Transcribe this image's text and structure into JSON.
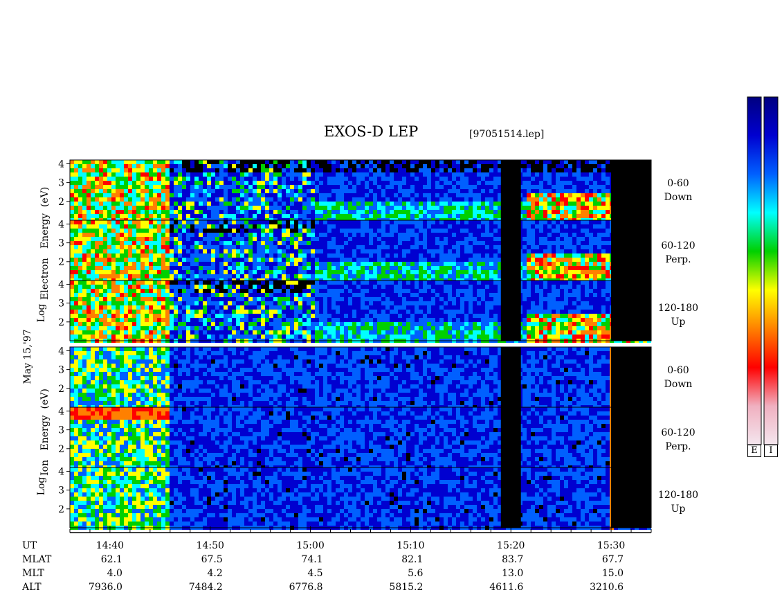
{
  "header": {
    "title": "EXOS-D LEP",
    "filename": "[97051514.lep]"
  },
  "date_label": "May 15,'97",
  "electron_axis_label": [
    "Electron",
    "Energy",
    "(eV)"
  ],
  "electron_axis_prefix": "Log",
  "ion_axis_label": [
    "Ion",
    "Energy",
    "(eV)"
  ],
  "ion_axis_prefix": "Log",
  "panels_electron": [
    {
      "angle": "0-60",
      "dir": "Down"
    },
    {
      "angle": "60-120",
      "dir": "Perp."
    },
    {
      "angle": "120-180",
      "dir": "Up"
    }
  ],
  "panels_ion": [
    {
      "angle": "0-60",
      "dir": "Down"
    },
    {
      "angle": "60-120",
      "dir": "Perp."
    },
    {
      "angle": "120-180",
      "dir": "Up"
    }
  ],
  "colorbar_tags": [
    "E",
    "I"
  ],
  "colors": {
    "colorbar": [
      "#f4e6ee",
      "#f0b0c0",
      "#ff0000",
      "#ff8000",
      "#ffff00",
      "#00d000",
      "#00ffff",
      "#0060ff",
      "#0000d0",
      "#000080"
    ],
    "data_gap": "#000000"
  },
  "chart_data": {
    "type": "heatmap",
    "title": "EXOS-D LEP",
    "xlabel": "UT",
    "ylabel": "Log Energy (eV)",
    "y_ticks": [
      "2",
      "3",
      "4"
    ],
    "ylim": [
      1,
      4.2
    ],
    "x_ticks": [
      "14:40",
      "14:50",
      "15:00",
      "15:10",
      "15:20",
      "15:30"
    ],
    "ephemeris": [
      {
        "label": "UT",
        "values": [
          "14:40",
          "14:50",
          "15:00",
          "15:10",
          "15:20",
          "15:30"
        ]
      },
      {
        "label": "MLAT",
        "values": [
          "62.1",
          "67.5",
          "74.1",
          "82.1",
          "83.7",
          "67.7"
        ]
      },
      {
        "label": "MLT",
        "values": [
          "4.0",
          "4.2",
          "4.5",
          "5.6",
          "13.0",
          "15.0"
        ]
      },
      {
        "label": "ALT",
        "values": [
          "7936.0",
          "7484.2",
          "6776.8",
          "5815.2",
          "4611.6",
          "3210.6"
        ]
      }
    ],
    "data_gaps_ut": [
      [
        "15:19",
        "15:21"
      ],
      [
        "15:30",
        "15:34"
      ]
    ]
  }
}
